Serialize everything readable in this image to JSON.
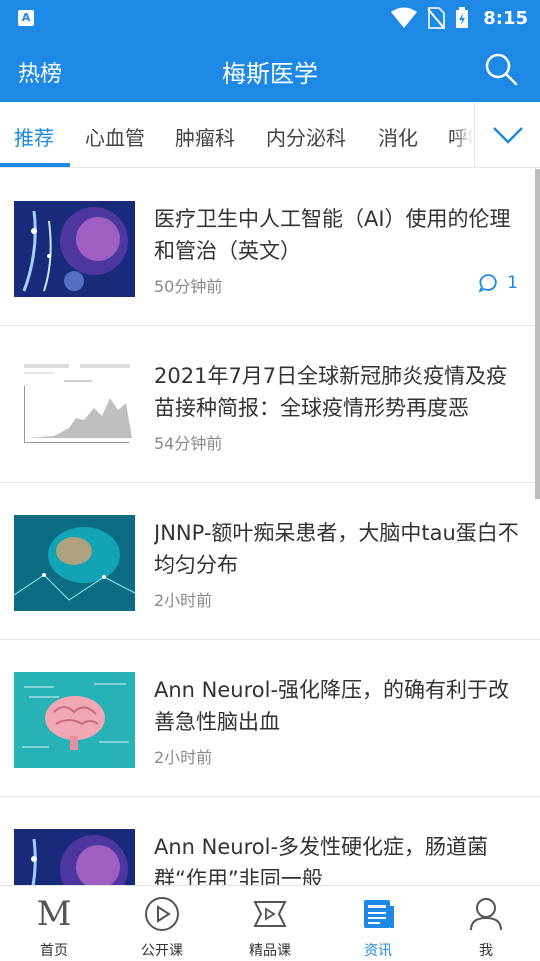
{
  "status_bar": {
    "time": "8:15",
    "app_badge": "A"
  },
  "app_bar": {
    "left_label": "热榜",
    "title": "梅斯医学"
  },
  "tabs": [
    {
      "label": "推荐",
      "active": true
    },
    {
      "label": "心血管",
      "active": false
    },
    {
      "label": "肿瘤科",
      "active": false
    },
    {
      "label": "内分泌科",
      "active": false
    },
    {
      "label": "消化",
      "active": false
    },
    {
      "label": "呼吸",
      "active": false
    }
  ],
  "feed": [
    {
      "title": "医疗卫生中人工智能（AI）使用的伦理和管治（英文）",
      "time": "50分钟前",
      "comments": "1",
      "thumb": "brain-network-neon"
    },
    {
      "title": "2021年7月7日全球新冠肺炎疫情及疫苗接种简报：全球疫情形势再度恶",
      "time": "54分钟前",
      "comments": "",
      "thumb": "chart-report"
    },
    {
      "title": "JNNP-额叶痴呆患者，大脑中tau蛋白不均匀分布",
      "time": "2小时前",
      "comments": "",
      "thumb": "brain-teal-digital"
    },
    {
      "title": "Ann Neurol-强化降压，的确有利于改善急性脑出血",
      "time": "2小时前",
      "comments": "",
      "thumb": "brain-pink-chalkboard"
    },
    {
      "title": "Ann Neurol-多发性硬化症，肠道菌群“作用”非同一般",
      "time": "",
      "comments": "",
      "thumb": "brain-network-neon"
    }
  ],
  "bottom_nav": [
    {
      "label": "首页",
      "icon": "m-logo-icon",
      "active": false
    },
    {
      "label": "公开课",
      "icon": "play-circle-icon",
      "active": false
    },
    {
      "label": "精品课",
      "icon": "film-icon",
      "active": false
    },
    {
      "label": "资讯",
      "icon": "news-icon",
      "active": true
    },
    {
      "label": "我",
      "icon": "user-icon",
      "active": false
    }
  ],
  "colors": {
    "primary": "#1e88e5",
    "text": "#333333",
    "muted": "#8a8a8a"
  }
}
